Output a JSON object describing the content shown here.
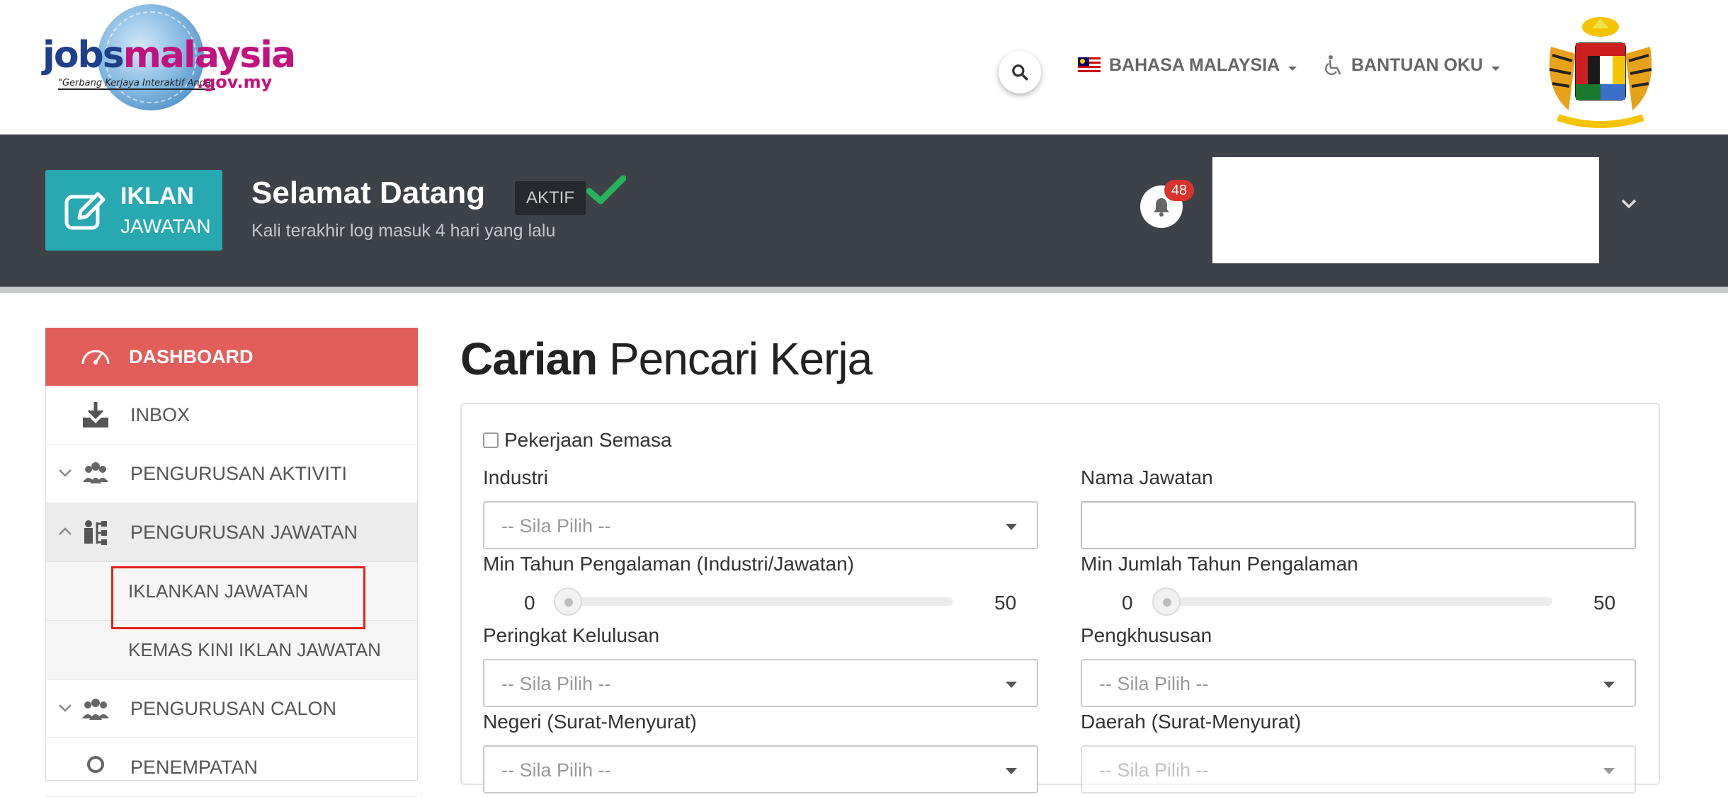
{
  "header": {
    "logo": {
      "brand_jobs": "jobs",
      "brand_malaysia": "malaysia",
      "gov": ".gov.my",
      "tagline": "\"Gerbang Kerjaya Interaktif Anda\""
    },
    "language_label": "BAHASA MALAYSIA",
    "accessibility_label": "BANTUAN OKU"
  },
  "banner": {
    "action_button": {
      "line1": "IKLAN",
      "line2": "JAWATAN"
    },
    "welcome_text": "Selamat Datang",
    "status_badge": "AKTIF",
    "last_login": "Kali terakhir log masuk 4 hari yang lalu",
    "notification_count": "48"
  },
  "sidebar": {
    "items": [
      {
        "label": "DASHBOARD"
      },
      {
        "label": "INBOX"
      },
      {
        "label": "PENGURUSAN AKTIVITI"
      },
      {
        "label": "PENGURUSAN JAWATAN"
      },
      {
        "label": "IKLANKAN JAWATAN"
      },
      {
        "label": "KEMAS KINI IKLAN JAWATAN"
      },
      {
        "label": "PENGURUSAN CALON"
      },
      {
        "label": "PENEMPATAN"
      }
    ]
  },
  "main": {
    "title_bold": "Carian",
    "title_rest": " Pencari Kerja",
    "form": {
      "current_job_label": "Pekerjaan Semasa",
      "industry": {
        "label": "Industri",
        "value": "-- Sila Pilih --"
      },
      "job_name": {
        "label": "Nama Jawatan",
        "value": ""
      },
      "min_years_industry": {
        "label": "Min Tahun Pengalaman (Industri/Jawatan)",
        "min": "0",
        "max": "50",
        "value": 0
      },
      "min_total_years": {
        "label": "Min Jumlah Tahun Pengalaman",
        "min": "0",
        "max": "50",
        "value": 0
      },
      "qualification": {
        "label": "Peringkat Kelulusan",
        "value": "-- Sila Pilih --"
      },
      "specialization": {
        "label": "Pengkhususan",
        "value": "-- Sila Pilih --"
      },
      "state": {
        "label": "Negeri (Surat-Menyurat)",
        "value": "-- Sila Pilih --"
      },
      "district": {
        "label": "Daerah (Surat-Menyurat)",
        "value": "-- Sila Pilih --"
      }
    }
  },
  "colors": {
    "banner_bg": "#3d4148",
    "action_button": "#28a8b0",
    "dashboard_active": "#e25e5a",
    "badge": "#d9342b",
    "highlight_box": "#e2231a",
    "check": "#27b35a"
  }
}
